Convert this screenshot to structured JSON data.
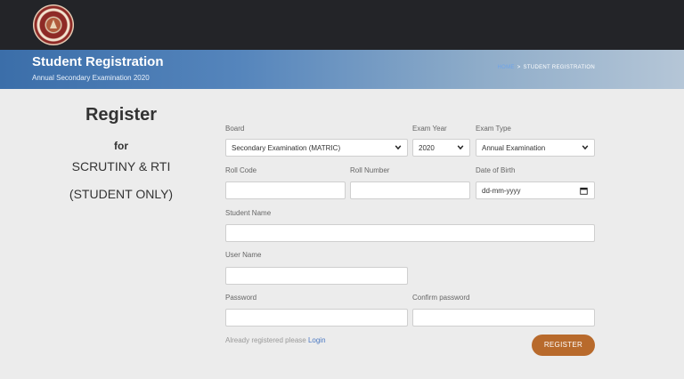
{
  "banner": {
    "title": "Student Registration",
    "subtitle": "Annual Secondary Examination 2020",
    "breadcrumb": {
      "home": "HOME",
      "separator": ">",
      "current": "STUDENT REGISTRATION"
    }
  },
  "intro": {
    "title": "Register",
    "for": "for",
    "line1": "SCRUTINY & RTI",
    "line2": "(STUDENT ONLY)"
  },
  "form": {
    "board_label": "Board",
    "board_value": "Secondary Examination (MATRIC)",
    "exam_year_label": "Exam Year",
    "exam_year_value": "2020",
    "exam_type_label": "Exam Type",
    "exam_type_value": "Annual Examination",
    "roll_code_label": "Roll Code",
    "roll_number_label": "Roll Number",
    "dob_label": "Date of Birth",
    "dob_placeholder": "dd-mm-yyyy",
    "student_name_label": "Student Name",
    "user_name_label": "User Name",
    "password_label": "Password",
    "confirm_password_label": "Confirm password"
  },
  "footer": {
    "already_text": "Already registered please",
    "login_link": "Login",
    "register_button": "REGISTER"
  },
  "colors": {
    "topbar": "#232428",
    "banner_start": "#3b6ea9",
    "accent_button": "#b86a2c",
    "link": "#4a78c2"
  }
}
